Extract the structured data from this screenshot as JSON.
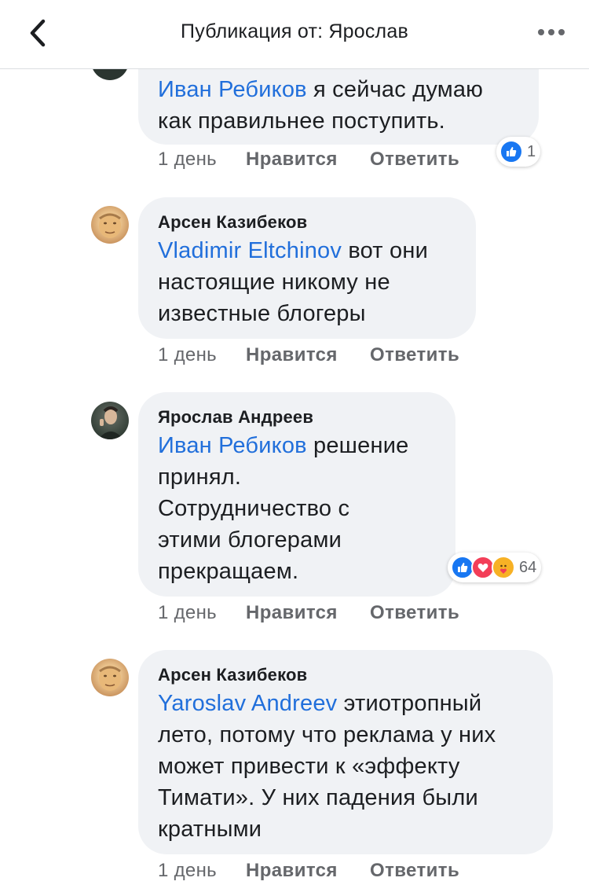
{
  "header": {
    "title": "Публикация от: Ярослав"
  },
  "comments": [
    {
      "mention": "Иван Ребиков",
      "text": " я сейчас думаю\nкак правильнее поступить.",
      "time": "1 день",
      "like_label": "Нравится",
      "reply_label": "Ответить",
      "reaction_count": "1"
    },
    {
      "author": "Арсен Казибеков",
      "mention": "Vladimir Eltchinov",
      "text": " вот они\nнастоящие  никому не\nизвестные блогеры",
      "time": "1 день",
      "like_label": "Нравится",
      "reply_label": "Ответить"
    },
    {
      "author": "Ярослав Андреев",
      "mention": "Иван Ребиков",
      "text": " решение\nпринял.\nСотрудничество с\nэтими блогерами\nпрекращаем.",
      "time": "1 день",
      "like_label": "Нравится",
      "reply_label": "Ответить",
      "reaction_count": "64"
    },
    {
      "author": "Арсен Казибеков",
      "mention": "Yaroslav Andreev",
      "text": " этиотропный\nлето, потому что реклама у них\nможет привести к «эффекту\nТимати». У них падения были\nкратными",
      "time": "1 день",
      "like_label": "Нравится",
      "reply_label": "Ответить"
    }
  ],
  "colors": {
    "mention": "#216fdb",
    "bubble": "#f0f2f5",
    "meta": "#65676b",
    "like_reaction": "#1877f2",
    "love_reaction": "#f33e58",
    "care_reaction": "#f7b125"
  },
  "icons": {
    "back": "chevron-left-icon",
    "more": "more-horizontal-icon",
    "reactions": [
      "like-reaction-icon",
      "love-reaction-icon",
      "care-reaction-icon"
    ]
  }
}
